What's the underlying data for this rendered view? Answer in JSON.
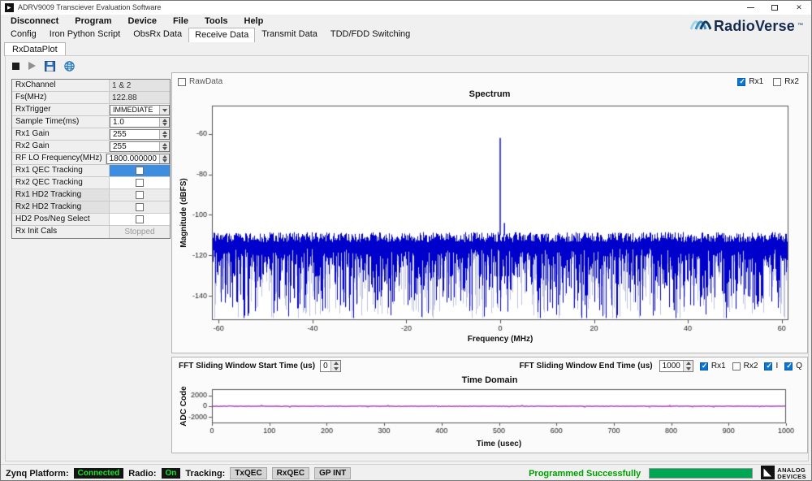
{
  "window": {
    "title": "ADRV9009 Transciever Evaluation Software"
  },
  "menubar": {
    "items": [
      "Disconnect",
      "Program",
      "Device",
      "File",
      "Tools",
      "Help"
    ]
  },
  "brand": {
    "name": "RadioVerse",
    "tm": "™"
  },
  "tabs": {
    "items": [
      "Config",
      "Iron Python Script",
      "ObsRx Data",
      "Receive Data",
      "Transmit Data",
      "TDD/FDD Switching"
    ],
    "active": "Receive Data"
  },
  "subtabs": {
    "items": [
      "RxDataPlot"
    ]
  },
  "properties": {
    "rows": [
      {
        "label": "RxChannel",
        "value": "1 & 2"
      },
      {
        "label": "Fs(MHz)",
        "value": "122.88"
      },
      {
        "label": "RxTrigger",
        "value": "IMMEDIATE"
      },
      {
        "label": "Sample Time(ms)",
        "value": "1.0"
      },
      {
        "label": "Rx1 Gain",
        "value": "255"
      },
      {
        "label": "Rx2 Gain",
        "value": "255"
      },
      {
        "label": "RF LO Frequency(MHz)",
        "value": "1800.000000"
      },
      {
        "label": "Rx1 QEC Tracking",
        "checked": false
      },
      {
        "label": "Rx2 QEC Tracking",
        "checked": false
      },
      {
        "label": "Rx1 HD2 Tracking",
        "checked": false
      },
      {
        "label": "Rx2 HD2 Tracking",
        "checked": false
      },
      {
        "label": "HD2 Pos/Neg Select",
        "checked": false
      },
      {
        "label": "Rx Init Cals",
        "value": "Stopped"
      }
    ]
  },
  "plot_panel": {
    "rawdata_label": "RawData",
    "rawdata_checked": false,
    "rx1_label": "Rx1",
    "rx1_checked": true,
    "rx2_label": "Rx2",
    "rx2_checked": false
  },
  "fft_controls": {
    "start_label": "FFT Sliding Window Start Time (us)",
    "start_value": "0",
    "end_label": "FFT Sliding Window End Time (us)",
    "end_value": "1000",
    "rx1_label": "Rx1",
    "rx1_checked": true,
    "rx2_label": "Rx2",
    "rx2_checked": false,
    "i_label": "I",
    "i_checked": true,
    "q_label": "Q",
    "q_checked": true
  },
  "status": {
    "zynq_label": "Zynq Platform:",
    "zynq_value": "Connected",
    "radio_label": "Radio:",
    "radio_value": "On",
    "tracking_label": "Tracking:",
    "badges": [
      "TxQEC",
      "RxQEC",
      "GP INT"
    ],
    "message": "Programmed Successfully"
  },
  "adi_logo": {
    "line1": "ANALOG",
    "line2": "DEVICES"
  },
  "colors": {
    "spectrum_trace": "#0000cc",
    "spectrum_underlay": "#a9b0d6",
    "time_trace_i": "#7030a0",
    "time_trace_q": "#cc00cc",
    "accent_check": "#0b76d1",
    "status_green": "#00a651"
  },
  "chart_data": [
    {
      "type": "line",
      "title": "Spectrum",
      "xlabel": "Frequency (MHz)",
      "ylabel": "Magnitude (dBFS)",
      "xlim": [
        -61.44,
        61.44
      ],
      "ylim": [
        -152,
        -46
      ],
      "xticks": [
        -60,
        -40,
        -20,
        0,
        20,
        40,
        60
      ],
      "yticks": [
        -60,
        -80,
        -100,
        -120,
        -140
      ],
      "grid": false,
      "legend_position": "none",
      "series": [
        {
          "name": "Rx1",
          "color": "#0000cc",
          "noise_floor_top_dbfs": -108,
          "noise_floor_mean_dbfs": -118,
          "noise_spike_min_dbfs": -152,
          "peaks": [
            {
              "x_mhz": 0,
              "y_dbfs": -62
            },
            {
              "x_mhz": 0.9,
              "y_dbfs": -104
            }
          ]
        }
      ]
    },
    {
      "type": "line",
      "title": "Time Domain",
      "xlabel": "Time (usec)",
      "ylabel": "ADC Code",
      "xlim": [
        0,
        1000
      ],
      "ylim": [
        -3200,
        3200
      ],
      "xticks": [
        0,
        100,
        200,
        300,
        400,
        500,
        600,
        700,
        800,
        900,
        1000
      ],
      "yticks": [
        2000,
        0,
        -2000
      ],
      "grid": false,
      "legend_position": "none",
      "series": [
        {
          "name": "Q",
          "color": "#cc00cc",
          "mean_adc": 0,
          "peak_adc": 120
        },
        {
          "name": "I",
          "color": "#7030a0",
          "mean_adc": 0,
          "peak_adc": 120
        }
      ]
    }
  ]
}
